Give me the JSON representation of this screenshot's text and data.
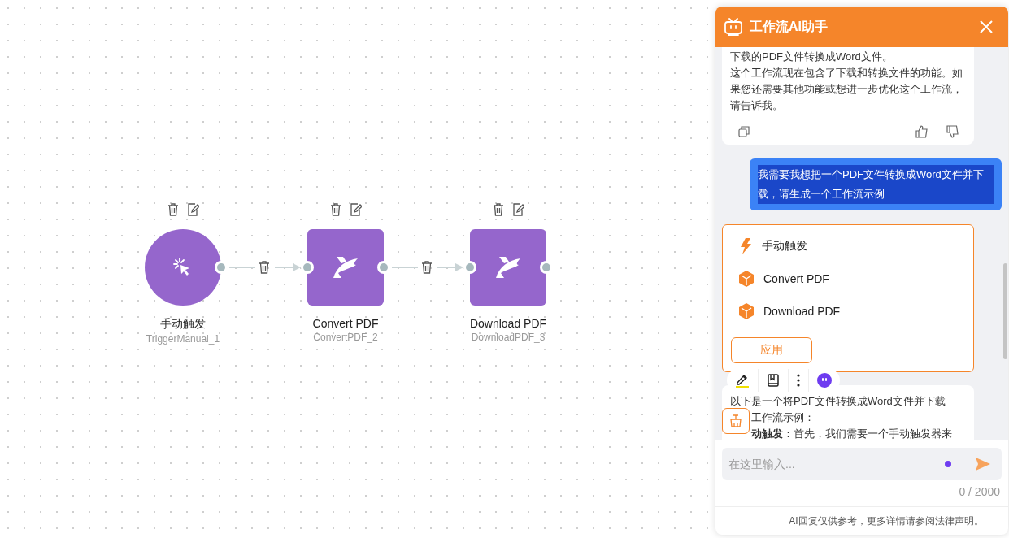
{
  "canvas": {
    "nodes": [
      {
        "kind": "trigger",
        "title": "手动触发",
        "subtitle": "TriggerManual_1"
      },
      {
        "kind": "action",
        "title": "Convert PDF",
        "subtitle": "ConvertPDF_2"
      },
      {
        "kind": "action",
        "title": "Download PDF",
        "subtitle": "DownloadPDF_3"
      }
    ]
  },
  "assistant": {
    "title": "工作流AI助手",
    "messages": [
      {
        "kind": "bot",
        "paragraphs": [
          "下载的PDF文件转换成Word文件。",
          "这个工作流现在包含了下载和转换文件的功能。如果您还需要其他功能或想进一步优化这个工作流，请告诉我。"
        ]
      },
      {
        "kind": "user",
        "text": "我需要我想把一个PDF文件转换成Word文件并下载，请生成一个工作流示例"
      },
      {
        "kind": "workflow",
        "items": [
          {
            "kind": "trigger",
            "label": "手动触发"
          },
          {
            "kind": "node",
            "label": "Convert PDF"
          },
          {
            "kind": "node",
            "label": "Download PDF"
          }
        ],
        "button": "应用"
      },
      {
        "kind": "bot_partial",
        "paragraphs": [
          "以下是一个将PDF文件转换成Word文件并下载",
          "工作流示例：",
          "**动触发**：首先，我们需要一个手动触发器来"
        ]
      }
    ],
    "input": {
      "placeholder": "在这里输入..."
    },
    "counter": "0 / 2000",
    "footer": "AI回复仅供参考，更多详情请参阅法律声明。"
  }
}
